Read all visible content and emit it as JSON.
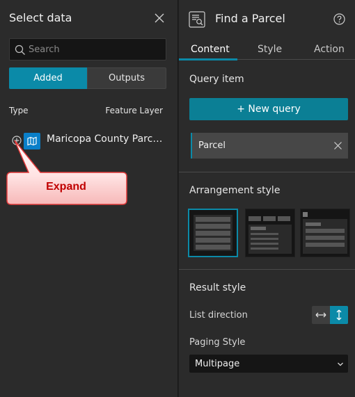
{
  "left_panel": {
    "title": "Select data",
    "search_placeholder": "Search",
    "tabs": [
      {
        "label": "Added",
        "active": true
      },
      {
        "label": "Outputs",
        "active": false
      }
    ],
    "columns": {
      "type": "Type",
      "layer": "Feature Layer"
    },
    "layers": [
      {
        "name": "Maricopa County Parcels",
        "icon": "map-icon"
      }
    ],
    "callout": {
      "text": "Expand",
      "color": "#c00000"
    }
  },
  "right_panel": {
    "title": "Find a Parcel",
    "tabs": [
      {
        "label": "Content",
        "active": true
      },
      {
        "label": "Style",
        "active": false
      },
      {
        "label": "Action",
        "active": false
      }
    ],
    "query_item": {
      "heading": "Query item",
      "new_query_label": "New query",
      "items": [
        {
          "label": "Parcel"
        }
      ]
    },
    "arrangement": {
      "heading": "Arrangement style",
      "selected_index": 0
    },
    "result_style": {
      "heading": "Result style",
      "list_direction_label": "List direction",
      "list_direction": "vertical",
      "paging_label": "Paging Style",
      "paging_value": "Multipage"
    }
  },
  "colors": {
    "accent": "#0b8aa8",
    "panel_bg": "#2b2b2b",
    "input_bg": "#151515"
  }
}
